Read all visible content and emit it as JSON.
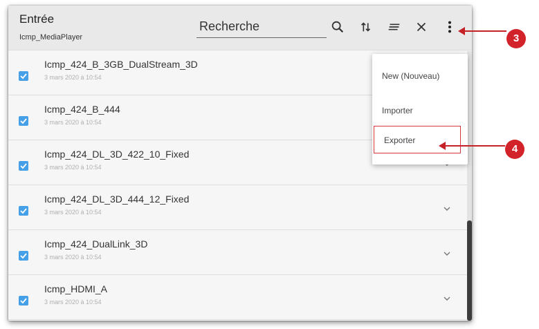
{
  "header": {
    "title": "Entrée",
    "subtitle": "Icmp_MediaPlayer",
    "search_placeholder": "Recherche"
  },
  "toolbar": {
    "icons": [
      "search-icon",
      "sort-icon",
      "filter-icon",
      "close-icon",
      "more-vert-icon"
    ]
  },
  "items": [
    {
      "name": "Icmp_424_B_3GB_DualStream_3D",
      "date": "3 mars 2020 à 10:54",
      "checked": true
    },
    {
      "name": "Icmp_424_B_444",
      "date": "3 mars 2020 à 10:54",
      "checked": true
    },
    {
      "name": "Icmp_424_DL_3D_422_10_Fixed",
      "date": "3 mars 2020 à 10:54",
      "checked": true
    },
    {
      "name": "Icmp_424_DL_3D_444_12_Fixed",
      "date": "3 mars 2020 à 10:54",
      "checked": true
    },
    {
      "name": "Icmp_424_DualLink_3D",
      "date": "3 mars 2020 à 10:54",
      "checked": true
    },
    {
      "name": "Icmp_HDMI_A",
      "date": "3 mars 2020 à 10:54",
      "checked": true
    }
  ],
  "menu": {
    "items": [
      "New (Nouveau)",
      "Importer",
      "Exporter"
    ]
  },
  "callouts": [
    "3",
    "4"
  ],
  "colors": {
    "accent": "#45a0e8",
    "callout": "#d3232a",
    "header_bg": "#e9e9e9"
  }
}
